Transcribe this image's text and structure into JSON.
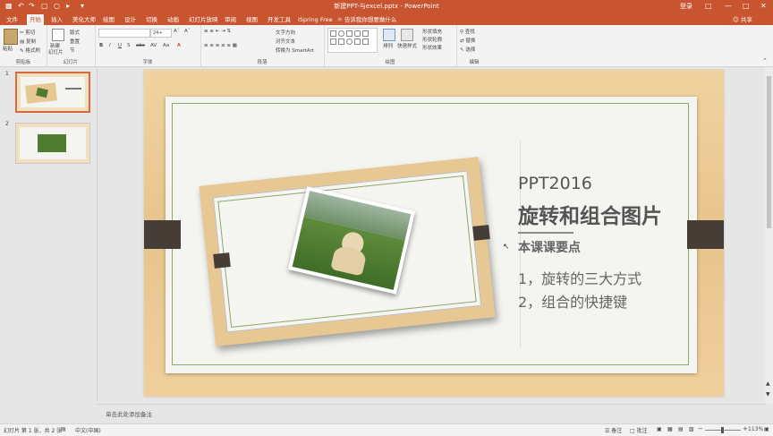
{
  "window": {
    "title": "新建PPT-与excel.pptx - PowerPoint",
    "login": "登录"
  },
  "tabs": [
    "文件",
    "开始",
    "插入",
    "美化大师",
    "绘图",
    "设计",
    "切换",
    "动画",
    "幻灯片放映",
    "审阅",
    "视图",
    "开发工具",
    "iSpring Free"
  ],
  "active_tab": "开始",
  "tell_me": "告诉我你想要做什么",
  "share": "共享",
  "ribbon": {
    "clipboard": {
      "paste": "粘贴",
      "cut": "剪切",
      "copy": "复制",
      "format_painter": "格式刷",
      "label": "剪贴板"
    },
    "slides": {
      "new_slide": "新建",
      "new_slide2": "幻灯片",
      "layout": "版式",
      "reset": "重置",
      "section": "节",
      "label": "幻灯片"
    },
    "font": {
      "size": "24+",
      "label": "字体"
    },
    "paragraph": {
      "text_direction": "文字方向",
      "align_text": "对齐文本",
      "smartart": "转换为 SmartArt",
      "label": "段落"
    },
    "drawing": {
      "arrange": "排列",
      "quick_styles": "快速样式",
      "fill": "形状填充",
      "outline": "形状轮廓",
      "effects": "形状效果",
      "label": "绘图"
    },
    "editing": {
      "find": "查找",
      "replace": "替换",
      "select": "选择",
      "label": "编辑"
    }
  },
  "thumbnails": [
    {
      "number": "1"
    },
    {
      "number": "2"
    }
  ],
  "slide": {
    "heading": "PPT2016",
    "title": "旋转和组合图片",
    "subtitle": "本课课要点",
    "point1": "1，旋转的三大方式",
    "point2": "2，组合的快捷键"
  },
  "notes_placeholder": "单击此处添加备注",
  "status": {
    "slide_info": "幻灯片 第 1 张，共 2 张",
    "language": "中文(中国)",
    "notes": "备注",
    "comments": "批注",
    "zoom": "113%"
  },
  "colors": {
    "accent": "#c8552f",
    "slide_wood": "#e8c48c",
    "tab_block": "#463d36",
    "frame_line": "#8ea86a"
  }
}
